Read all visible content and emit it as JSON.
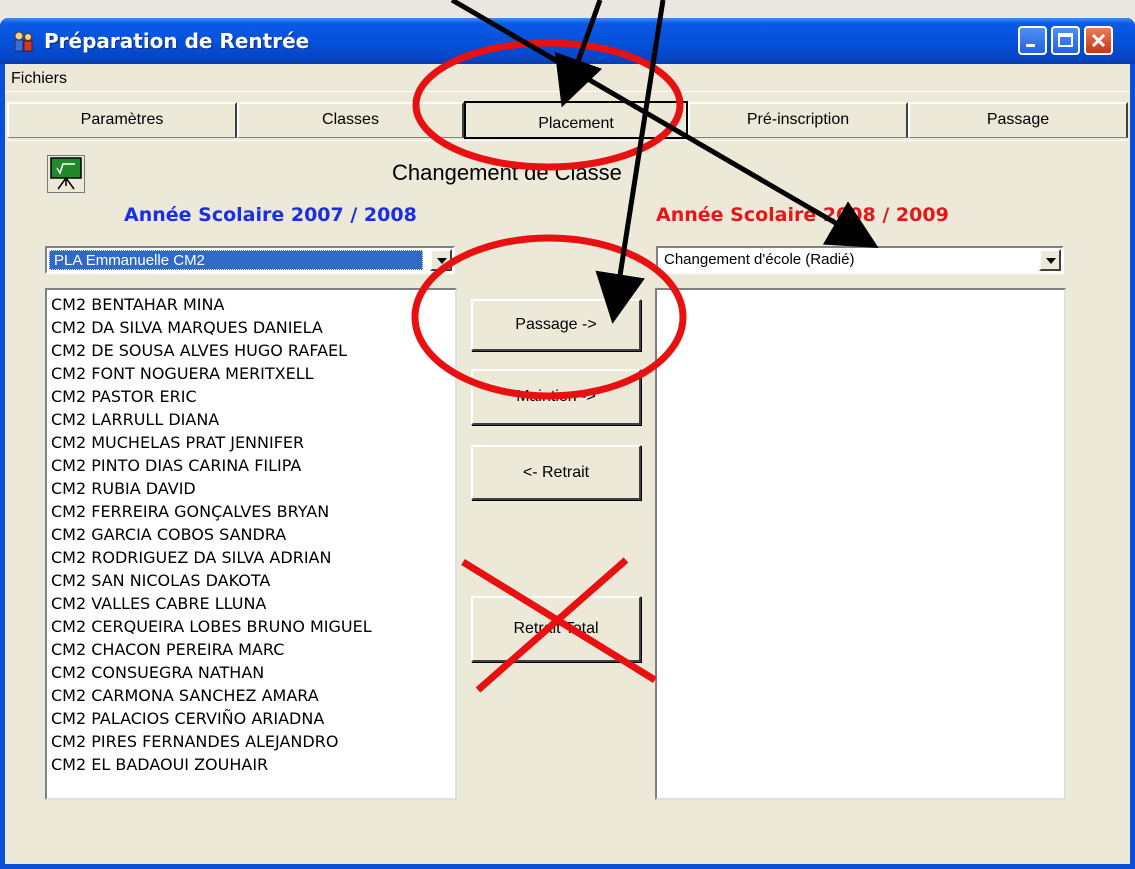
{
  "window": {
    "title": "Préparation de Rentrée"
  },
  "menu": {
    "items": [
      "Fichiers"
    ]
  },
  "tabs": [
    "Paramètres",
    "Classes",
    "Placement",
    "Pré-inscription",
    "Passage"
  ],
  "active_tab": "Placement",
  "heading": "Changement de Classe",
  "left": {
    "year_label": "Année Scolaire 2007 / 2008",
    "class_select": "PLA Emmanuelle CM2",
    "students": [
      "CM2 BENTAHAR MINA",
      "CM2 DA SILVA MARQUES DANIELA",
      "CM2 DE SOUSA ALVES HUGO RAFAEL",
      "CM2 FONT NOGUERA MERITXELL",
      "CM2 PASTOR ERIC",
      "CM2 LARRULL DIANA",
      "CM2 MUCHELAS PRAT JENNIFER",
      "CM2 PINTO DIAS  CARINA FILIPA",
      "CM2 RUBIA  DAVID",
      "CM2 FERREIRA GONÇALVES BRYAN",
      "CM2 GARCIA COBOS  SANDRA",
      "CM2 RODRIGUEZ DA SILVA ADRIAN",
      "CM2 SAN NICOLAS DAKOTA",
      "CM2 VALLES CABRE LLUNA",
      "CM2 CERQUEIRA LOBES BRUNO MIGUEL",
      "CM2 CHACON PEREIRA MARC",
      "CM2 CONSUEGRA  NATHAN",
      "CM2 CARMONA SANCHEZ AMARA",
      "CM2 PALACIOS CERVIÑO ARIADNA",
      "CM2 PIRES FERNANDES ALEJANDRO",
      "CM2 EL BADAOUI ZOUHAIR"
    ]
  },
  "right": {
    "year_label": "Année Scolaire 2008 / 2009",
    "destination_select": "Changement d'école (Radié)",
    "students": []
  },
  "buttons": {
    "passage": "Passage ->",
    "maintien": "Maintien ->",
    "retrait": "<- Retrait",
    "retrait_total": "Retrait Total"
  },
  "colors": {
    "left_year": "#1a2ee8",
    "right_year": "#e81616",
    "annotation": "#e81010",
    "titlebar": "#0552db"
  },
  "icons": {
    "app": "people-icon",
    "logo": "chalkboard-icon",
    "dropdown": "triangle-down-icon"
  }
}
